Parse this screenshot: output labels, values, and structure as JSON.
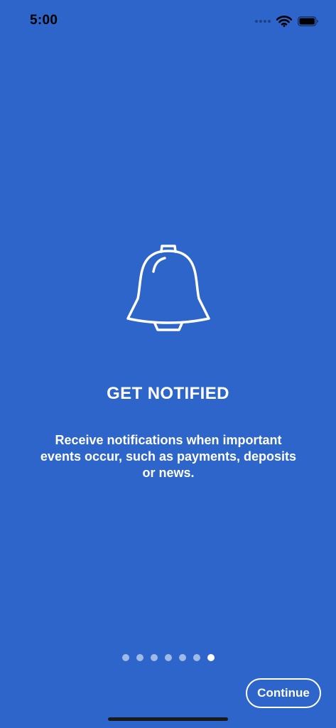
{
  "status_bar": {
    "time": "5:00"
  },
  "onboarding": {
    "title": "GET NOTIFIED",
    "description": "Receive notifications when important events occur, such as payments, deposits or news.",
    "icon": "bell-icon",
    "page_count": 7,
    "current_page": 7
  },
  "actions": {
    "continue_label": "Continue"
  },
  "colors": {
    "background": "#2D65CA",
    "foreground": "#FFFFFF"
  }
}
